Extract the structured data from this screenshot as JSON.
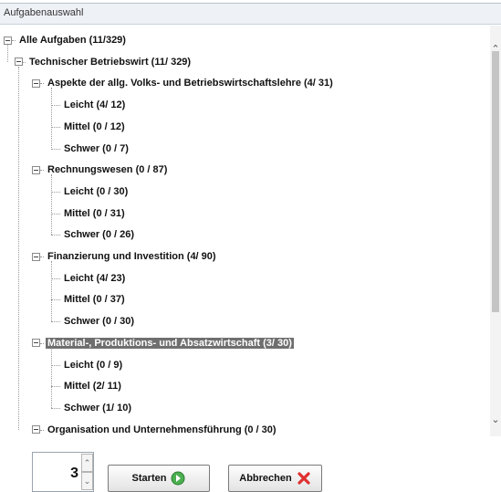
{
  "window": {
    "title": "Aufgabenauswahl"
  },
  "tree": [
    {
      "label": "Alle Aufgaben (11/329)",
      "level": 0,
      "expander": true,
      "selected": false
    },
    {
      "label": "Technischer Betriebswirt (11/ 329)",
      "level": 1,
      "expander": true,
      "selected": false
    },
    {
      "label": "Aspekte der allg. Volks- und Betriebswirtschaftslehre (4/ 31)",
      "level": 2,
      "expander": true,
      "selected": false
    },
    {
      "label": "Leicht (4/ 12)",
      "level": 3,
      "expander": false,
      "selected": false
    },
    {
      "label": "Mittel (0 / 12)",
      "level": 3,
      "expander": false,
      "selected": false
    },
    {
      "label": "Schwer (0 / 7)",
      "level": 3,
      "expander": false,
      "selected": false
    },
    {
      "label": "Rechnungswesen (0 / 87)",
      "level": 2,
      "expander": true,
      "selected": false
    },
    {
      "label": "Leicht (0 / 30)",
      "level": 3,
      "expander": false,
      "selected": false
    },
    {
      "label": "Mittel (0 / 31)",
      "level": 3,
      "expander": false,
      "selected": false
    },
    {
      "label": "Schwer (0 / 26)",
      "level": 3,
      "expander": false,
      "selected": false
    },
    {
      "label": "Finanzierung und Investition (4/ 90)",
      "level": 2,
      "expander": true,
      "selected": false
    },
    {
      "label": "Leicht (4/ 23)",
      "level": 3,
      "expander": false,
      "selected": false
    },
    {
      "label": "Mittel (0 / 37)",
      "level": 3,
      "expander": false,
      "selected": false
    },
    {
      "label": "Schwer (0 / 30)",
      "level": 3,
      "expander": false,
      "selected": false
    },
    {
      "label": "Material-, Produktions- und Absatzwirtschaft (3/ 30)",
      "level": 2,
      "expander": true,
      "selected": true
    },
    {
      "label": "Leicht (0 / 9)",
      "level": 3,
      "expander": false,
      "selected": false
    },
    {
      "label": "Mittel (2/ 11)",
      "level": 3,
      "expander": false,
      "selected": false
    },
    {
      "label": "Schwer (1/ 10)",
      "level": 3,
      "expander": false,
      "selected": false
    },
    {
      "label": "Organisation und Unternehmensführung (0 / 30)",
      "level": 2,
      "expander": true,
      "selected": false
    }
  ],
  "footer": {
    "count_value": "3",
    "start_label": "Starten",
    "start_icon": "go-green-icon",
    "cancel_label": "Abbrechen",
    "cancel_icon": "red-x-icon"
  },
  "colors": {
    "selected_bg": "#6f6f6f",
    "start_icon": "#4caf50",
    "cancel_icon": "#e03030"
  }
}
